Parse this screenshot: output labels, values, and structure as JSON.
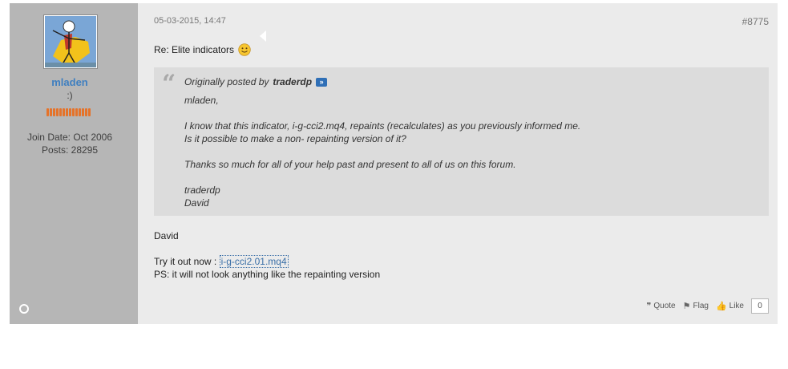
{
  "user": {
    "name": "mladen",
    "title": ":)",
    "join_date": "Join Date: Oct 2006",
    "posts": "Posts: 28295"
  },
  "post": {
    "date": "05-03-2015, 14:47",
    "number": "#8775",
    "title": "Re: Elite indicators"
  },
  "quote": {
    "prefix": "Originally posted by",
    "author": "traderdp",
    "lines": [
      "mladen,",
      "",
      "I know that this indicator, i-g-cci2.mq4, repaints (recalculates) as you previously informed me.",
      "Is it possible to make a non- repainting version of it?",
      "",
      "Thanks so much for all of your help past and present to all of us on this forum.",
      "",
      "traderdp",
      "David"
    ]
  },
  "body": {
    "greeting": "David",
    "try_prefix": "Try it out now :",
    "attachment": "i-g-cci2.01.mq4",
    "ps": "PS: it will not look anything like the repainting version"
  },
  "controls": {
    "quote_label": "Quote",
    "flag_label": "Flag",
    "like_label": "Like",
    "like_count": "0"
  },
  "colors": {
    "sidebar_bg": "#b6b6b6",
    "content_bg": "#ebebeb",
    "quote_bg": "#dcdcdc",
    "username": "#3f7fc0",
    "link": "#3a6fa7"
  }
}
